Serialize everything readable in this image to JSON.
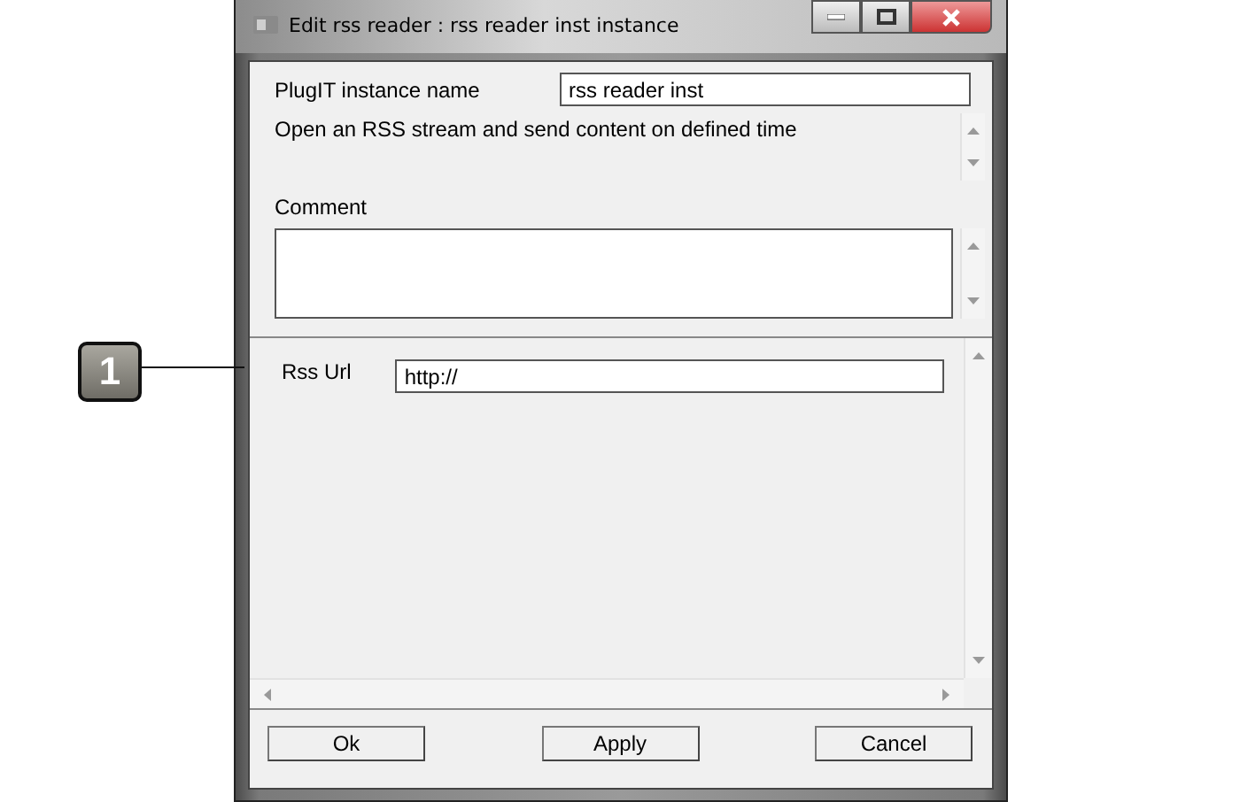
{
  "callout": {
    "number": "1"
  },
  "window": {
    "title": "Edit rss reader : rss reader inst instance"
  },
  "instance_name": {
    "label": "PlugIT instance name",
    "value": "rss reader inst"
  },
  "description": "Open an RSS stream and send content on defined time",
  "comment": {
    "label": "Comment"
  },
  "rss_url": {
    "label": "Rss Url",
    "value": "http://"
  },
  "buttons": [
    "Ok",
    "Apply",
    "Cancel"
  ]
}
